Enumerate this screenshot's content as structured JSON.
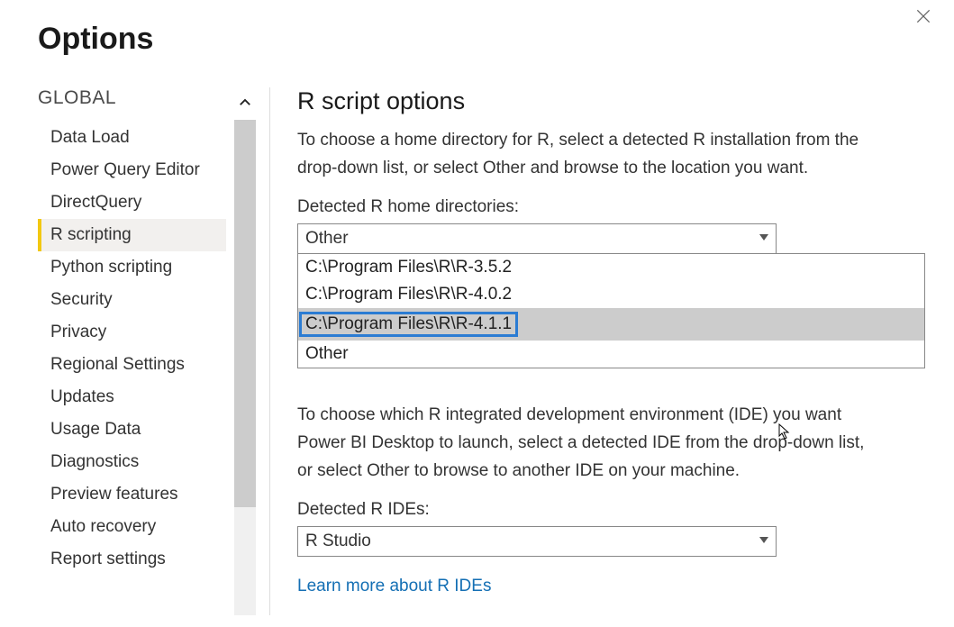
{
  "window": {
    "title": "Options"
  },
  "sidebar": {
    "section": "GLOBAL",
    "items": [
      {
        "label": "Data Load"
      },
      {
        "label": "Power Query Editor"
      },
      {
        "label": "DirectQuery"
      },
      {
        "label": "R scripting"
      },
      {
        "label": "Python scripting"
      },
      {
        "label": "Security"
      },
      {
        "label": "Privacy"
      },
      {
        "label": "Regional Settings"
      },
      {
        "label": "Updates"
      },
      {
        "label": "Usage Data"
      },
      {
        "label": "Diagnostics"
      },
      {
        "label": "Preview features"
      },
      {
        "label": "Auto recovery"
      },
      {
        "label": "Report settings"
      }
    ],
    "selected_index": 3
  },
  "main": {
    "title": "R script options",
    "intro": "To choose a home directory for R, select a detected R installation from the drop-down list, or select Other and browse to the location you want.",
    "detected_dirs_label": "Detected R home directories:",
    "detected_dirs_value": "Other",
    "detected_dirs_options": [
      "C:\\Program Files\\R\\R-3.5.2",
      "C:\\Program Files\\R\\R-4.0.2",
      "C:\\Program Files\\R\\R-4.1.1",
      "Other"
    ],
    "detected_dirs_hover_index": 2,
    "ide_intro": "To choose which R integrated development environment (IDE) you want Power BI Desktop to launch, select a detected IDE from the drop-down list, or select Other to browse to another IDE on your machine.",
    "detected_ides_label": "Detected R IDEs:",
    "detected_ides_value": "R Studio",
    "learn_more": "Learn more about R IDEs"
  }
}
